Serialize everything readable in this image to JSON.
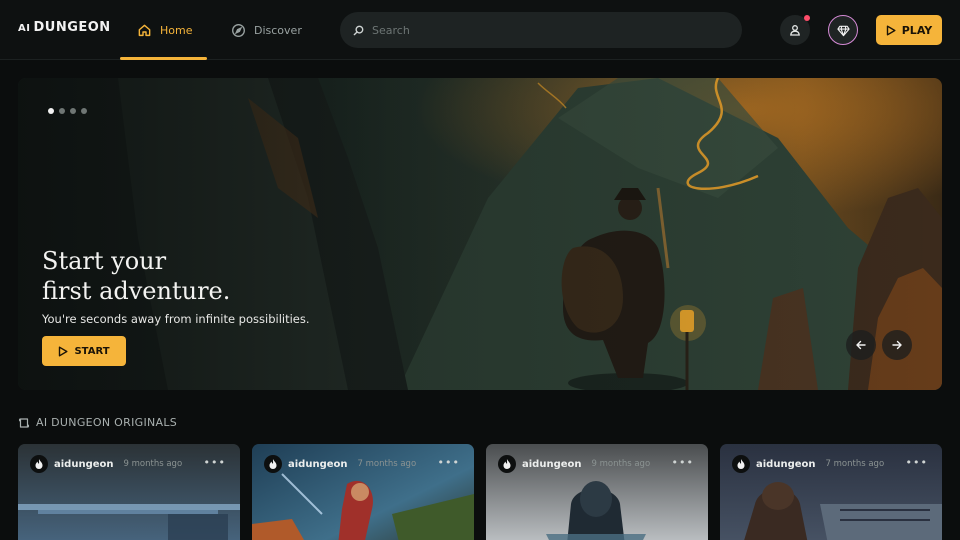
{
  "header": {
    "logo_prefix": "AI",
    "logo_name": "DUNGEON",
    "tabs": [
      {
        "label": "Home",
        "icon": "home-icon",
        "active": true
      },
      {
        "label": "Discover",
        "icon": "compass-icon",
        "active": false
      }
    ],
    "search_placeholder": "Search",
    "play_label": "PLAY",
    "accent_color": "#f5b43a"
  },
  "hero": {
    "title_line1": "Start your",
    "title_line2": "first adventure.",
    "subtitle": "You're seconds away from infinite possibilities.",
    "start_label": "START",
    "slide_count": 4,
    "active_slide": 1
  },
  "section": {
    "title": "AI DUNGEON ORIGINALS",
    "icon": "scroll-icon"
  },
  "cards": [
    {
      "author": "aidungeon",
      "time": "9 months ago"
    },
    {
      "author": "aidungeon",
      "time": "7 months ago"
    },
    {
      "author": "aidungeon",
      "time": "9 months ago"
    },
    {
      "author": "aidungeon",
      "time": "7 months ago"
    }
  ]
}
